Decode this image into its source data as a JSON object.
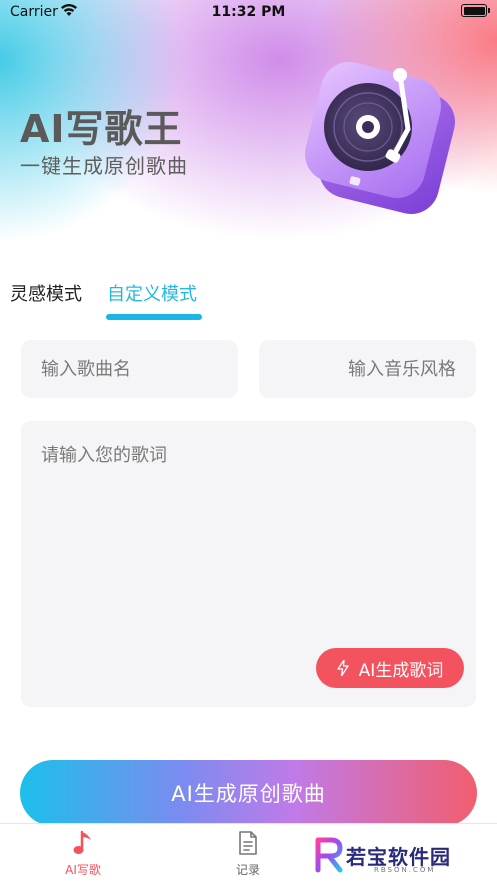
{
  "status_bar": {
    "carrier": "Carrier",
    "time": "11:32 PM"
  },
  "header": {
    "title": "AI写歌王",
    "subtitle": "一键生成原创歌曲"
  },
  "mode_tabs": [
    {
      "label": "灵感模式",
      "active": false
    },
    {
      "label": "自定义模式",
      "active": true
    }
  ],
  "form": {
    "song_name_placeholder": "输入歌曲名",
    "music_style_placeholder": "输入音乐风格",
    "lyrics_placeholder": "请输入您的歌词",
    "ai_lyrics_button": "AI生成歌词"
  },
  "generate_button": "AI生成原创歌曲",
  "tab_bar": [
    {
      "label": "AI写歌",
      "icon": "music-note-icon",
      "active": true
    },
    {
      "label": "记录",
      "icon": "document-icon",
      "active": false
    }
  ],
  "watermark": {
    "text": "若宝软件园",
    "sub": "RBSON.COM"
  },
  "colors": {
    "accent_blue": "#19b6e6",
    "accent_red": "#f2535f",
    "title_gray": "#5a5a5a"
  }
}
